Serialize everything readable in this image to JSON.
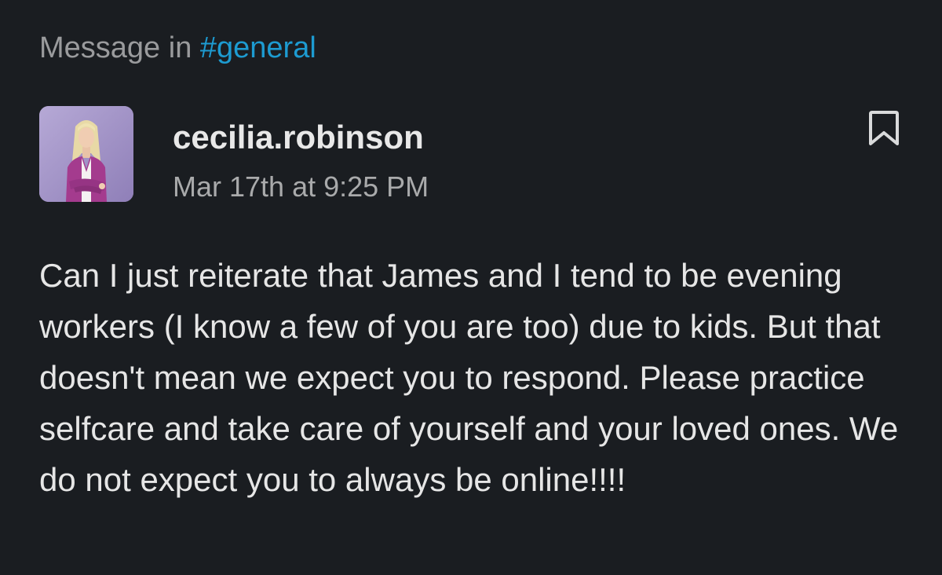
{
  "header": {
    "prefix": "Message in ",
    "channel": "#general"
  },
  "post": {
    "author": "cecilia.robinson",
    "timestamp": "Mar 17th at 9:25 PM",
    "body": "Can I just reiterate that James and I tend to be evening workers (I know a few of you are too) due to kids. But that doesn't mean we expect you to respond. Please practice selfcare and take care of yourself and your loved ones. We do not expect you to always be online!!!!",
    "avatar_icon": "user-photo-avatar",
    "bookmark_icon": "bookmark-icon"
  },
  "colors": {
    "background": "#1a1d21",
    "channel_link": "#1d9bd1",
    "avatar_background": "#a898c8",
    "avatar_jacket": "#a43b8e"
  }
}
